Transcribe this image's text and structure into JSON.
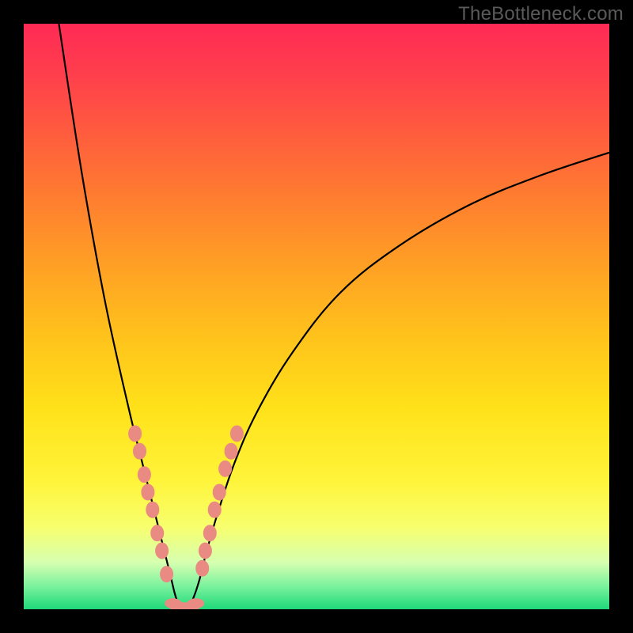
{
  "watermark": "TheBottleneck.com",
  "colors": {
    "frame": "#000000",
    "curve": "#000000",
    "dot": "#e98b82",
    "gradient_top": "#ff2a55",
    "gradient_bottom": "#1fd97a"
  },
  "chart_data": {
    "type": "line",
    "title": "",
    "xlabel": "",
    "ylabel": "",
    "xlim": [
      0,
      100
    ],
    "ylim": [
      0,
      100
    ],
    "annotations": [
      "TheBottleneck.com"
    ],
    "description": "V-shaped bottleneck curve over red-to-green vertical gradient; minimum near x≈27 at y≈0; left branch rises steeply to y=100 at x≈6; right branch rises and asymptotes near y≈78 at x=100.",
    "series": [
      {
        "name": "bottleneck-curve",
        "x": [
          6,
          10,
          14,
          18,
          20,
          22,
          24,
          25,
          26,
          27,
          28,
          29,
          30,
          31,
          33,
          36,
          40,
          46,
          54,
          64,
          76,
          88,
          100
        ],
        "y": [
          100,
          74,
          52,
          34,
          26,
          18,
          10,
          6,
          2,
          0,
          0,
          2,
          5,
          9,
          16,
          25,
          34,
          44,
          54,
          62,
          69,
          74,
          78
        ]
      }
    ],
    "markers": {
      "name": "highlighted-points",
      "left_branch": [
        {
          "x": 19.0,
          "y": 30
        },
        {
          "x": 19.8,
          "y": 27
        },
        {
          "x": 20.6,
          "y": 23
        },
        {
          "x": 21.2,
          "y": 20
        },
        {
          "x": 22.0,
          "y": 17
        },
        {
          "x": 22.8,
          "y": 13
        },
        {
          "x": 23.6,
          "y": 10
        },
        {
          "x": 24.4,
          "y": 6
        }
      ],
      "right_branch": [
        {
          "x": 30.5,
          "y": 7
        },
        {
          "x": 31.0,
          "y": 10
        },
        {
          "x": 31.8,
          "y": 13
        },
        {
          "x": 32.6,
          "y": 17
        },
        {
          "x": 33.4,
          "y": 20
        },
        {
          "x": 34.4,
          "y": 24
        },
        {
          "x": 35.4,
          "y": 27
        },
        {
          "x": 36.4,
          "y": 30
        }
      ],
      "bottom_flat": [
        {
          "x": 25.5,
          "y": 1.0
        },
        {
          "x": 26.3,
          "y": 0.5
        },
        {
          "x": 27.0,
          "y": 0.3
        },
        {
          "x": 27.8,
          "y": 0.3
        },
        {
          "x": 28.6,
          "y": 0.5
        },
        {
          "x": 29.4,
          "y": 1.0
        }
      ]
    }
  }
}
